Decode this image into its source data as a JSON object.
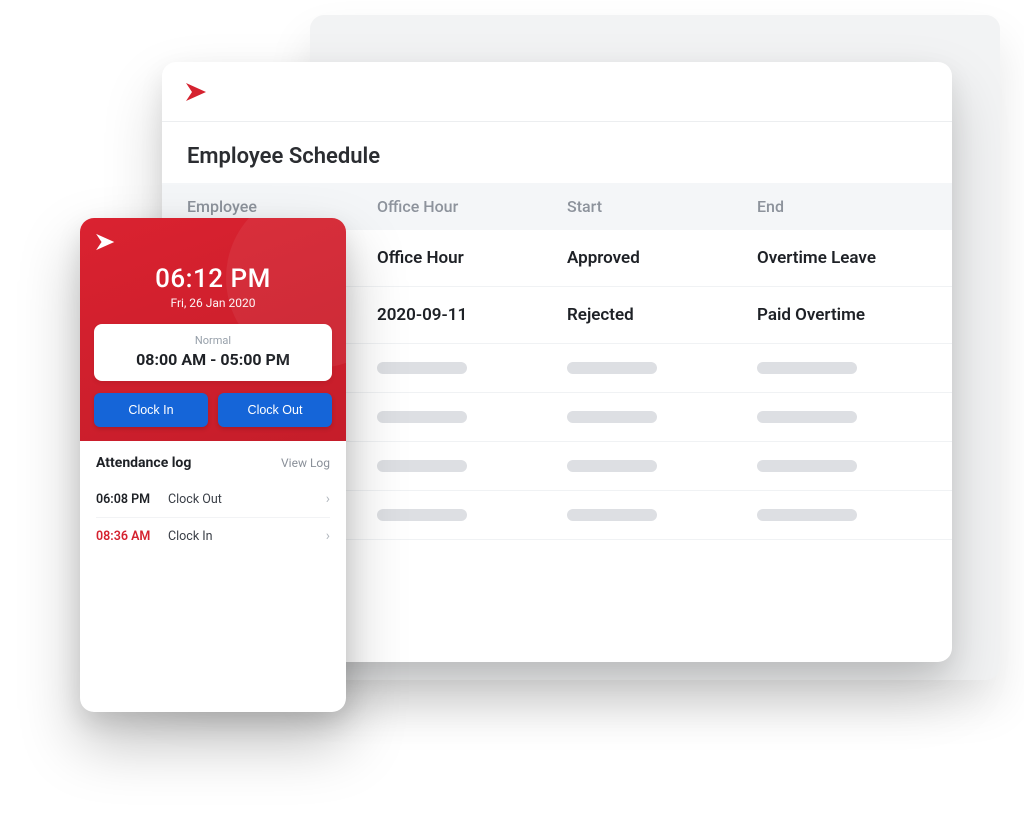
{
  "brand_color": "#d5222f",
  "desktop": {
    "title": "Employee Schedule",
    "columns": [
      "Employee",
      "Office Hour",
      "Start",
      "End"
    ],
    "rows": [
      {
        "employee": "",
        "office_hour": "Office Hour",
        "start": "Approved",
        "end": "Overtime Leave"
      },
      {
        "employee": "",
        "office_hour": "2020-09-11",
        "start": "Rejected",
        "end": "Paid Overtime"
      }
    ]
  },
  "mobile": {
    "time": "06:12 PM",
    "date": "Fri, 26 Jan 2020",
    "shift_label": "Normal",
    "shift_hours": "08:00 AM - 05:00 PM",
    "clock_in_label": "Clock In",
    "clock_out_label": "Clock Out",
    "attendance_title": "Attendance log",
    "view_log_label": "View Log",
    "logs": [
      {
        "time": "06:08 PM",
        "action": "Clock Out",
        "late": false
      },
      {
        "time": "08:36 AM",
        "action": "Clock In",
        "late": true
      }
    ]
  }
}
